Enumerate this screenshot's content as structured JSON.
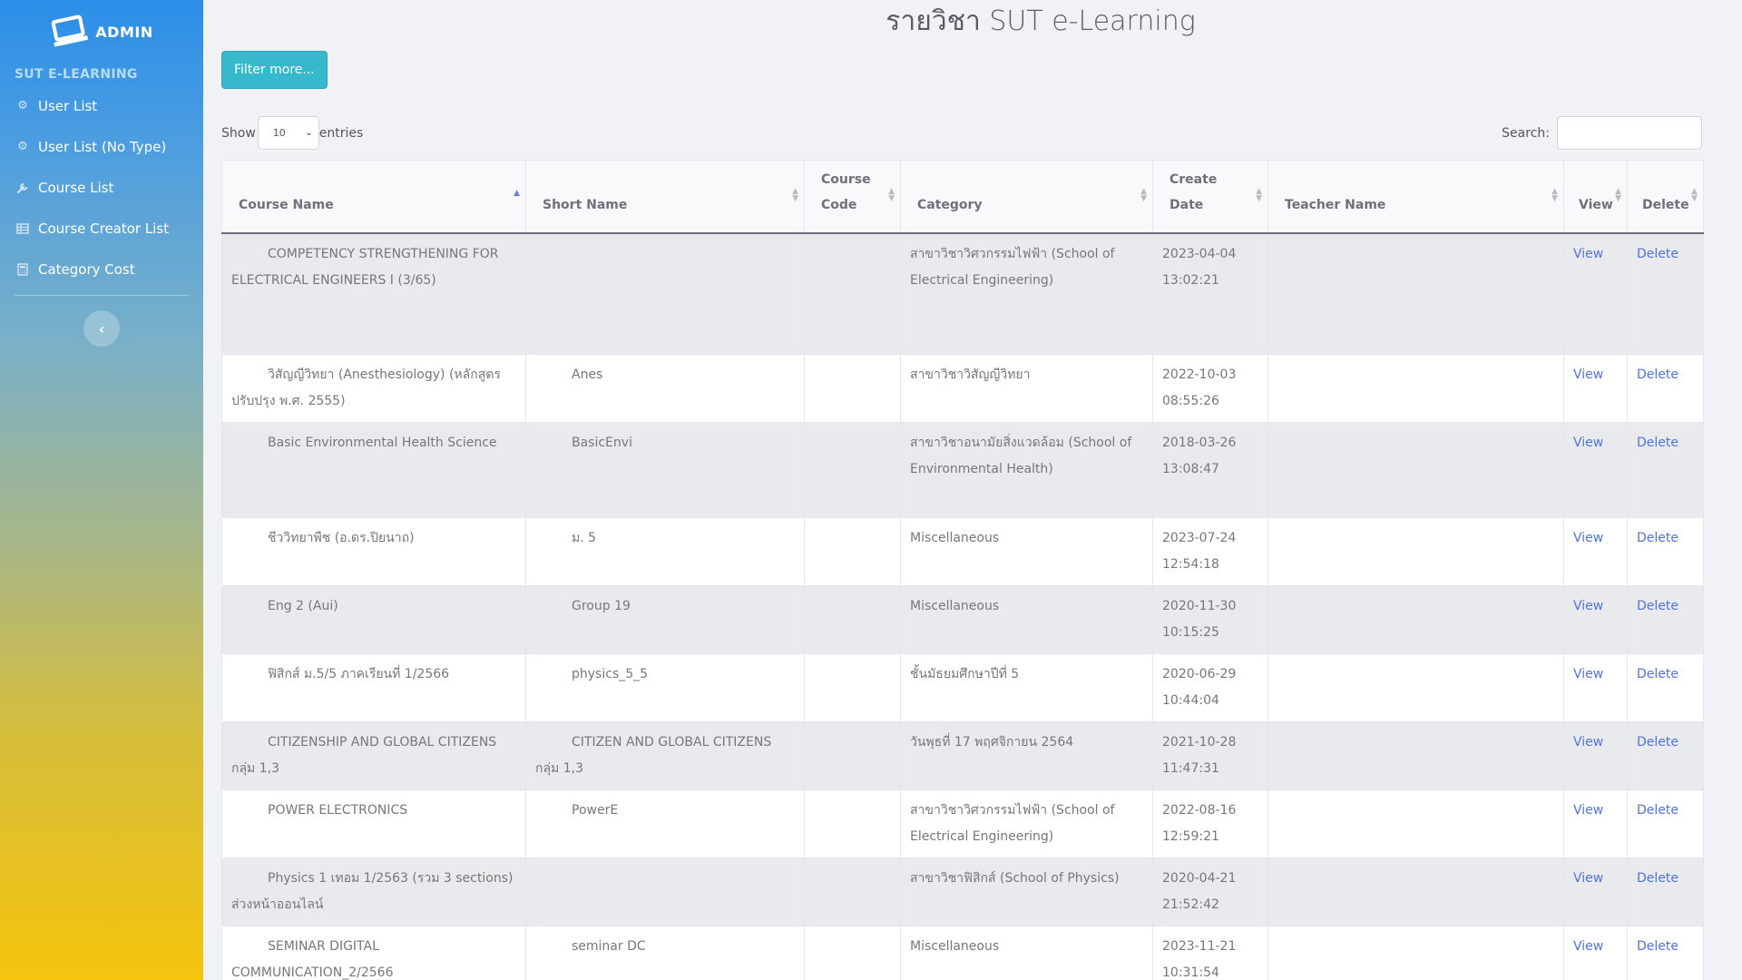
{
  "sidebar": {
    "brand": "ADMIN",
    "heading": "SUT E-LEARNING",
    "items": [
      {
        "label": "User List",
        "icon": "gear-icon"
      },
      {
        "label": "User List (No Type)",
        "icon": "gear-icon"
      },
      {
        "label": "Course List",
        "icon": "wrench-icon"
      },
      {
        "label": "Course Creator List",
        "icon": "table-icon"
      },
      {
        "label": "Category Cost",
        "icon": "calculator-icon"
      }
    ],
    "collapse_icon": "chevron-left-icon"
  },
  "page": {
    "title": "รายวิชา SUT e-Learning",
    "filter_button": "Filter more..."
  },
  "table_controls": {
    "show_label": "Show",
    "entries_value": "10",
    "entries_label": "entries",
    "search_label": "Search:",
    "search_value": ""
  },
  "table": {
    "columns": [
      {
        "label": "Course Name",
        "sorted": "asc"
      },
      {
        "label": "Short Name"
      },
      {
        "label": "Course Code"
      },
      {
        "label": "Category"
      },
      {
        "label": "Create Date"
      },
      {
        "label": "Teacher Name"
      },
      {
        "label": "View"
      },
      {
        "label": "Delete"
      }
    ],
    "view_label": "View",
    "delete_label": "Delete",
    "rows": [
      {
        "course_name": "COMPETENCY STRENGTHENING FOR ELECTRICAL ENGINEERS I (3/65)",
        "short_name": "",
        "course_code": "",
        "category": "สาขาวิชาวิศวกรรมไฟฟ้า (School of Electrical Engineering)",
        "create_date": "2023-04-04 13:02:21",
        "teacher": ""
      },
      {
        "course_name": "วิสัญญีวิทยา (Anesthesiology) (หลักสูตรปรับปรุง พ.ศ. 2555)",
        "short_name": "Anes",
        "course_code": "",
        "category": "สาขาวิชาวิสัญญีวิทยา",
        "create_date": "2022-10-03 08:55:26",
        "teacher": ""
      },
      {
        "course_name": "Basic Environmental Health Science",
        "short_name": "BasicEnvi",
        "course_code": "",
        "category": "สาขาวิชาอนามัยสิ่งแวดล้อม (School of Environmental Health)",
        "create_date": "2018-03-26 13:08:47",
        "teacher": ""
      },
      {
        "course_name": "ชีววิทยาพืช (อ.ดร.ปิยนาถ)",
        "short_name": "ม. 5",
        "course_code": "",
        "category": "Miscellaneous",
        "create_date": "2023-07-24 12:54:18",
        "teacher": ""
      },
      {
        "course_name": "Eng 2 (Aui)",
        "short_name": "Group 19",
        "course_code": "",
        "category": "Miscellaneous",
        "create_date": "2020-11-30 10:15:25",
        "teacher": ""
      },
      {
        "course_name": "ฟิสิกส์ ม.5/5 ภาคเรียนที่ 1/2566",
        "short_name": "physics_5_5",
        "course_code": "",
        "category": "ชั้นมัธยมศึกษาปีที่ 5",
        "create_date": "2020-06-29 10:44:04",
        "teacher": ""
      },
      {
        "course_name": "CITIZENSHIP AND GLOBAL CITIZENS กลุ่ม 1,3",
        "short_name": "CITIZEN AND GLOBAL CITIZENS กลุ่ม 1,3",
        "course_code": "",
        "category": "วันพุธที่ 17 พฤศจิกายน 2564",
        "create_date": "2021-10-28 11:47:31",
        "teacher": ""
      },
      {
        "course_name": "POWER ELECTRONICS",
        "short_name": "PowerE",
        "course_code": "",
        "category": "สาขาวิชาวิศวกรรมไฟฟ้า (School of Electrical Engineering)",
        "create_date": "2022-08-16 12:59:21",
        "teacher": ""
      },
      {
        "course_name": "Physics 1 เทอม 1/2563 (รวม 3 sections) ส่วงหน้าออนไลน์",
        "short_name": "",
        "course_code": "",
        "category": "สาขาวิชาฟิสิกส์ (School of Physics)",
        "create_date": "2020-04-21 21:52:42",
        "teacher": ""
      },
      {
        "course_name": "SEMINAR DIGITAL COMMUNICATION_2/2566",
        "short_name": "seminar DC",
        "course_code": "",
        "category": "Miscellaneous",
        "create_date": "2023-11-21 10:31:54",
        "teacher": ""
      }
    ]
  }
}
